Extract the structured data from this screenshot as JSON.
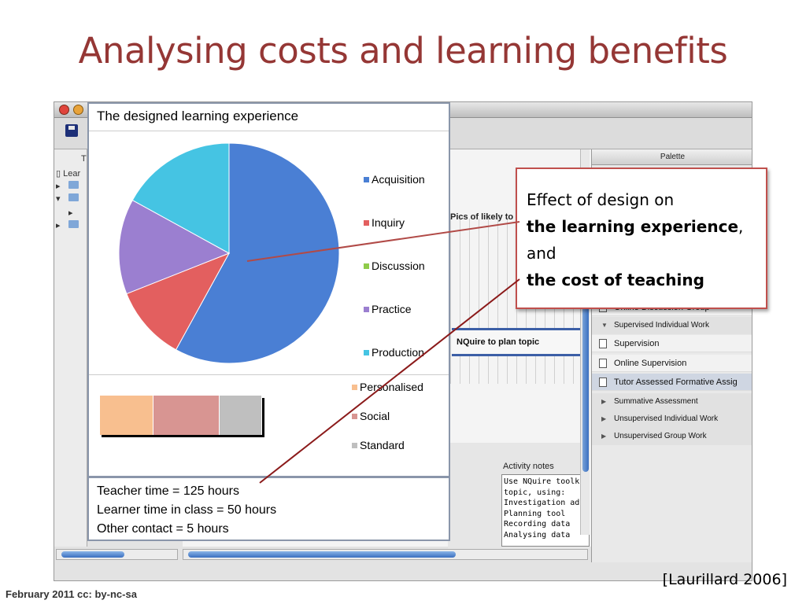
{
  "slide": {
    "title": "Analysing costs and learning benefits",
    "citation": "[Laurillard 2006]",
    "footer": "February 2011 cc: by-nc-sa"
  },
  "app": {
    "tree_items": [
      "T",
      "Lear"
    ],
    "canvas_text": "Pics of likely to",
    "task_label": "NQuire to plan topic",
    "activity_notes_label": "Activity notes",
    "activity_notes": [
      "Use NQuire toolk",
      "topic, using:",
      "Investigation adv",
      "Planning tool",
      "Recording data",
      "Analysing data"
    ],
    "palette": {
      "title": "Palette",
      "items": [
        {
          "label": "Online Discussion Group",
          "kind": "doc"
        },
        {
          "label": "Supervised Individual Work",
          "kind": "expanded"
        },
        {
          "label": "Supervision",
          "kind": "doc"
        },
        {
          "label": "Online Supervision",
          "kind": "doc"
        },
        {
          "label": "Tutor Assessed Formative Assig",
          "kind": "doc-selected"
        },
        {
          "label": "Summative Assessment",
          "kind": "collapsed"
        },
        {
          "label": "Unsupervised Individual Work",
          "kind": "collapsed"
        },
        {
          "label": "Unsupervised Group Work",
          "kind": "collapsed"
        }
      ]
    }
  },
  "chart_data": [
    {
      "type": "pie",
      "title": "The designed learning experience",
      "categories": [
        "Acquisition",
        "Inquiry",
        "Discussion",
        "Practice",
        "Production"
      ],
      "values": [
        58,
        11,
        0,
        14,
        17
      ],
      "colors": [
        "#4a7fd4",
        "#e35f5f",
        "#8fcb4a",
        "#9b7fd0",
        "#45c4e3"
      ],
      "legend": "right"
    },
    {
      "type": "bar",
      "stacked": true,
      "orientation": "horizontal",
      "categories": [
        "Personalised",
        "Social",
        "Standard"
      ],
      "values": [
        33,
        41,
        26
      ],
      "colors": [
        "#f8bf8f",
        "#d89592",
        "#bfbfbf"
      ],
      "legend": "right"
    }
  ],
  "time_summary": {
    "teacher_time": "Teacher time = 125 hours",
    "learner_time": "Learner time in class = 50 hours",
    "other_contact": "Other contact = 5 hours"
  },
  "callout": {
    "line1": "Effect of design on",
    "line2_bold": "the learning experience",
    "line2_rest": ",",
    "line3": "and",
    "line4_bold": "the cost of teaching"
  }
}
